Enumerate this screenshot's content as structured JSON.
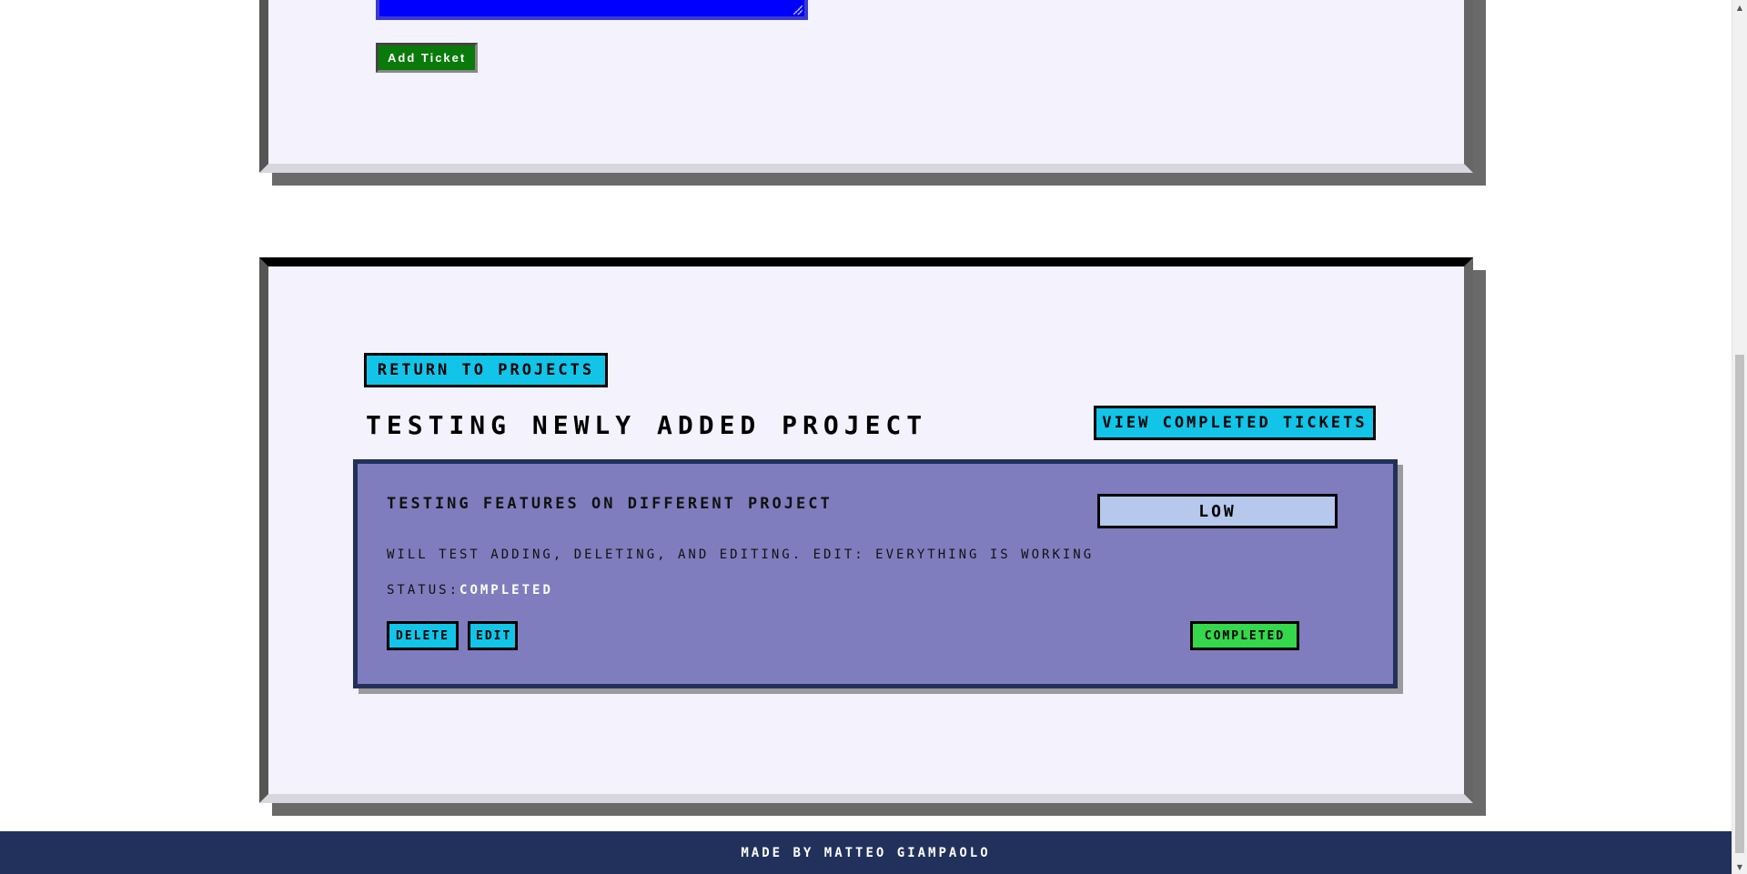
{
  "top_form": {
    "add_ticket_label": "Add Ticket"
  },
  "project": {
    "return_label": "Return to Projects",
    "title": "Testing Newly Added Project",
    "view_completed_label": "View Completed Tickets",
    "tickets": [
      {
        "title": "Testing features on different project",
        "priority": "Low",
        "description": "Will test adding, deleting, and editing. Edit: everything is working",
        "status_label": "Status:",
        "status_value": "Completed",
        "delete_label": "Delete",
        "edit_label": "Edit",
        "completed_label": "Completed"
      }
    ]
  },
  "footer": {
    "text": "Made by Matteo Giampaolo"
  },
  "colors": {
    "panel_bg": "#f4f2fc",
    "ticket_bg": "#7f7dbd",
    "accent_cyan": "#12c4e8",
    "add_green": "#0a7a0a",
    "completed_green": "#35d84a",
    "priority_bg": "#b6c8ec",
    "footer_bg": "#22305c",
    "textarea_blue": "#0000ff"
  }
}
